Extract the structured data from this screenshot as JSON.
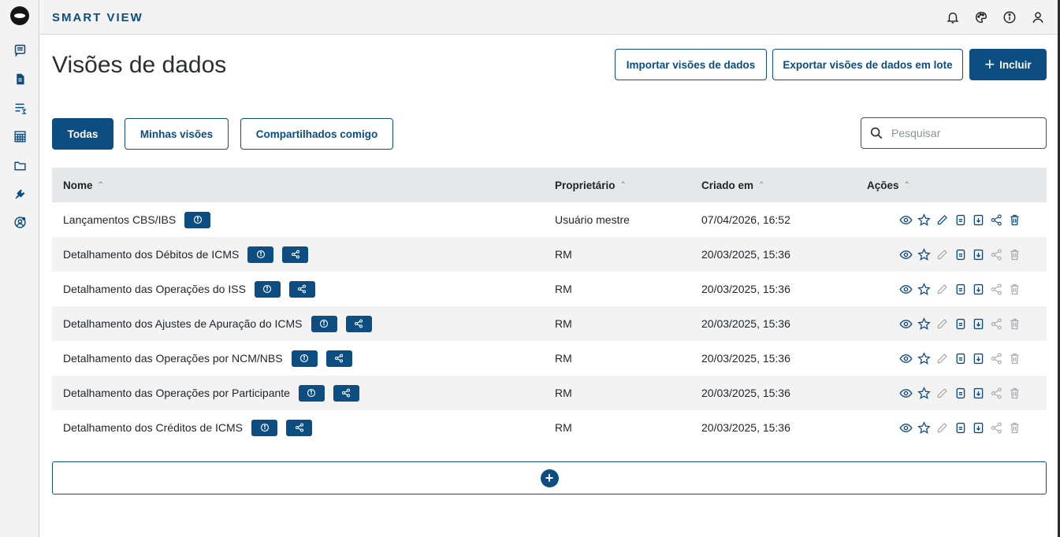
{
  "app": {
    "brand": "SMART VIEW"
  },
  "sidebar": {
    "items": [
      {
        "icon": "message-icon"
      },
      {
        "icon": "document-icon"
      },
      {
        "icon": "formula-list-icon"
      },
      {
        "icon": "grid-table-icon"
      },
      {
        "icon": "folder-icon"
      },
      {
        "icon": "plugin-icon"
      },
      {
        "icon": "user-settings-icon"
      }
    ]
  },
  "header_icons": [
    "bell-icon",
    "palette-icon",
    "info-icon",
    "user-icon"
  ],
  "page": {
    "title": "Visões de dados"
  },
  "toolbar": {
    "import_label": "Importar visões de dados",
    "export_label": "Exportar visões de dados em lote",
    "add_label": "Incluir"
  },
  "filters": {
    "all": "Todas",
    "mine": "Minhas visões",
    "shared": "Compartilhados comigo"
  },
  "search": {
    "placeholder": "Pesquisar",
    "value": ""
  },
  "table": {
    "columns": {
      "name": "Nome",
      "owner": "Proprietário",
      "created": "Criado em",
      "actions": "Ações"
    },
    "rows": [
      {
        "name": "Lançamentos CBS/IBS",
        "owner": "Usuário mestre",
        "created": "07/04/2026, 16:52",
        "shared": false,
        "editable": true
      },
      {
        "name": "Detalhamento dos Débitos de ICMS",
        "owner": "RM",
        "created": "20/03/2025, 15:36",
        "shared": true,
        "editable": false
      },
      {
        "name": "Detalhamento das Operações do ISS",
        "owner": "RM",
        "created": "20/03/2025, 15:36",
        "shared": true,
        "editable": false
      },
      {
        "name": "Detalhamento dos Ajustes de Apuração do ICMS",
        "owner": "RM",
        "created": "20/03/2025, 15:36",
        "shared": true,
        "editable": false
      },
      {
        "name": "Detalhamento das Operações por NCM/NBS",
        "owner": "RM",
        "created": "20/03/2025, 15:36",
        "shared": true,
        "editable": false
      },
      {
        "name": "Detalhamento das Operações por Participante",
        "owner": "RM",
        "created": "20/03/2025, 15:36",
        "shared": true,
        "editable": false
      },
      {
        "name": "Detalhamento dos Créditos de ICMS",
        "owner": "RM",
        "created": "20/03/2025, 15:36",
        "shared": true,
        "editable": false
      }
    ]
  },
  "colors": {
    "primary": "#0c4d82",
    "disabled": "#a7abb0",
    "header_bg": "#e6e7e9"
  }
}
